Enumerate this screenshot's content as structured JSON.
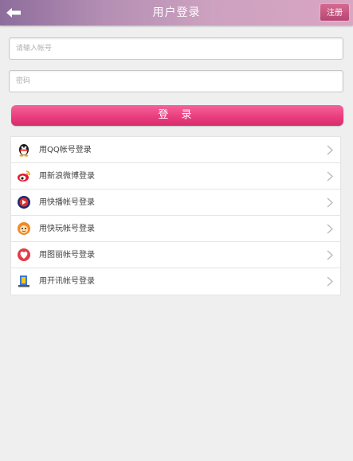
{
  "header": {
    "title": "用户登录",
    "register_label": "注册"
  },
  "form": {
    "account_placeholder": "请输入帐号",
    "password_placeholder": "密码",
    "login_label": "登 录"
  },
  "third_party": [
    {
      "label": "用QQ帐号登录",
      "icon": "qq-penguin-icon"
    },
    {
      "label": "用新浪微博登录",
      "icon": "sina-weibo-icon"
    },
    {
      "label": "用快播帐号登录",
      "icon": "kuaibo-icon"
    },
    {
      "label": "用快玩帐号登录",
      "icon": "kuaiwan-icon"
    },
    {
      "label": "用图丽帐号登录",
      "icon": "tuli-icon"
    },
    {
      "label": "用开讯帐号登录",
      "icon": "kaixun-icon"
    }
  ],
  "colors": {
    "accent_pink": "#ea3f7e",
    "background": "#efefef"
  }
}
